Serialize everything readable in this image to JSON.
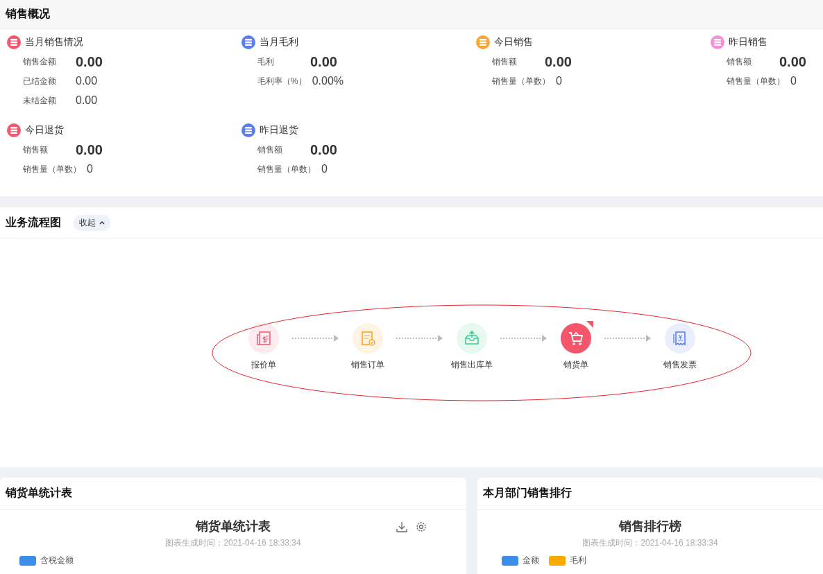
{
  "overview": {
    "title": "销售概况",
    "cards": [
      {
        "title": "当月销售情况",
        "color": "#f5566b",
        "items": [
          {
            "kind": "main",
            "label": "销售金额",
            "value": "0.00"
          },
          {
            "kind": "sub",
            "label": "已结金额",
            "value": "0.00"
          },
          {
            "kind": "sub",
            "label": "未结金额",
            "value": "0.00"
          }
        ]
      },
      {
        "title": "当月毛利",
        "color": "#5b7ff0",
        "items": [
          {
            "kind": "main",
            "label": "毛利",
            "value": "0.00"
          },
          {
            "kind": "sub",
            "label": "毛利率（%）",
            "value": "0.00%"
          }
        ]
      },
      {
        "title": "今日销售",
        "color": "#f7a631",
        "items": [
          {
            "kind": "main",
            "label": "销售额",
            "value": "0.00"
          },
          {
            "kind": "sub",
            "label": "销售量（单数）",
            "value": "0"
          }
        ]
      },
      {
        "title": "昨日销售",
        "color": "#f58fd9",
        "items": [
          {
            "kind": "main",
            "label": "销售额",
            "value": "0.00"
          },
          {
            "kind": "sub",
            "label": "销售量（单数）",
            "value": "0"
          }
        ]
      },
      {
        "title": "今日退货",
        "color": "#f5566b",
        "items": [
          {
            "kind": "main",
            "label": "销售额",
            "value": "0.00"
          },
          {
            "kind": "sub",
            "label": "销售量（单数）",
            "value": "0"
          }
        ]
      },
      {
        "title": "昨日退货",
        "color": "#5b7ff0",
        "items": [
          {
            "kind": "main",
            "label": "销售额",
            "value": "0.00"
          },
          {
            "kind": "sub",
            "label": "销售量（单数）",
            "value": "0"
          }
        ]
      }
    ]
  },
  "process": {
    "title": "业务流程图",
    "toggle": {
      "label": "收起",
      "expanded": true
    },
    "steps": [
      {
        "kind": "quote",
        "label": "报价单",
        "color": "#f0607a",
        "selected": false
      },
      {
        "kind": "order",
        "label": "销售订单",
        "color": "#f5a623",
        "selected": false
      },
      {
        "kind": "outbound",
        "label": "销售出库单",
        "color": "#3ecf8e",
        "selected": false
      },
      {
        "kind": "cart",
        "label": "销货单",
        "color": "#f5566b",
        "selected": true
      },
      {
        "kind": "invoice",
        "label": "销售发票",
        "color": "#5b7ff0",
        "selected": false
      }
    ]
  },
  "panels": [
    {
      "title": "销货单统计表",
      "chart_title": "销货单统计表",
      "generated": "图表生成时间：2021-04-16 18:33:34",
      "tools": true,
      "legend": [
        {
          "label": "含税金额",
          "color": "#3d8ee8"
        }
      ]
    },
    {
      "title": "本月部门销售排行",
      "chart_title": "销售排行榜",
      "generated": "图表生成时间：2021-04-16 18:33:34",
      "tools": false,
      "legend": [
        {
          "label": "金额",
          "color": "#3d8ee8"
        },
        {
          "label": "毛利",
          "color": "#fbab00"
        }
      ]
    }
  ]
}
